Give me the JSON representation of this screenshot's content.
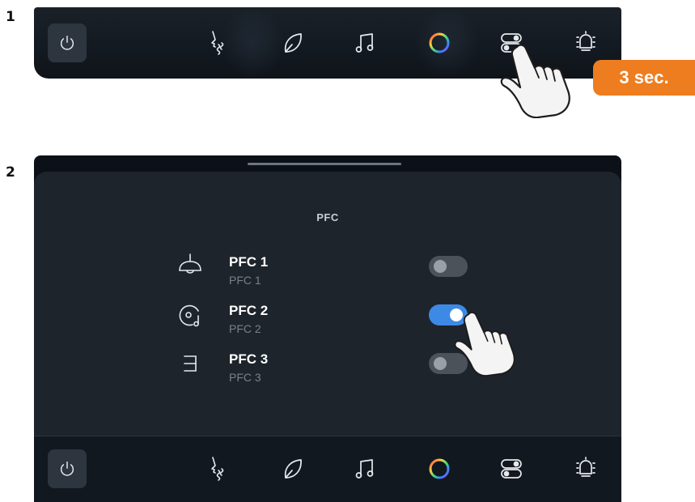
{
  "steps": {
    "step1_label": "1",
    "step2_label": "2"
  },
  "badge": {
    "label": "3 sec."
  },
  "panel": {
    "title": "PFC",
    "items": [
      {
        "title": "PFC 1",
        "subtitle": "PFC 1",
        "icon": "ceiling-lamp-icon",
        "enabled": false
      },
      {
        "title": "PFC 2",
        "subtitle": "PFC 2",
        "icon": "disc-music-icon",
        "enabled": true
      },
      {
        "title": "PFC 3",
        "subtitle": "PFC 3",
        "icon": "bracket-shelf-icon",
        "enabled": false
      }
    ]
  },
  "bottom_bar": {
    "icons": [
      "power-icon",
      "face-ventilation-icon",
      "leaf-icon",
      "music-note-icon",
      "color-ring-icon",
      "toggles-icon",
      "brightness-icon"
    ]
  },
  "colors": {
    "accent_toggle_on": "#3d8ae6",
    "badge": "#ee7d1f",
    "bar_bg": "#131920",
    "panel_bg": "#1e242b"
  }
}
